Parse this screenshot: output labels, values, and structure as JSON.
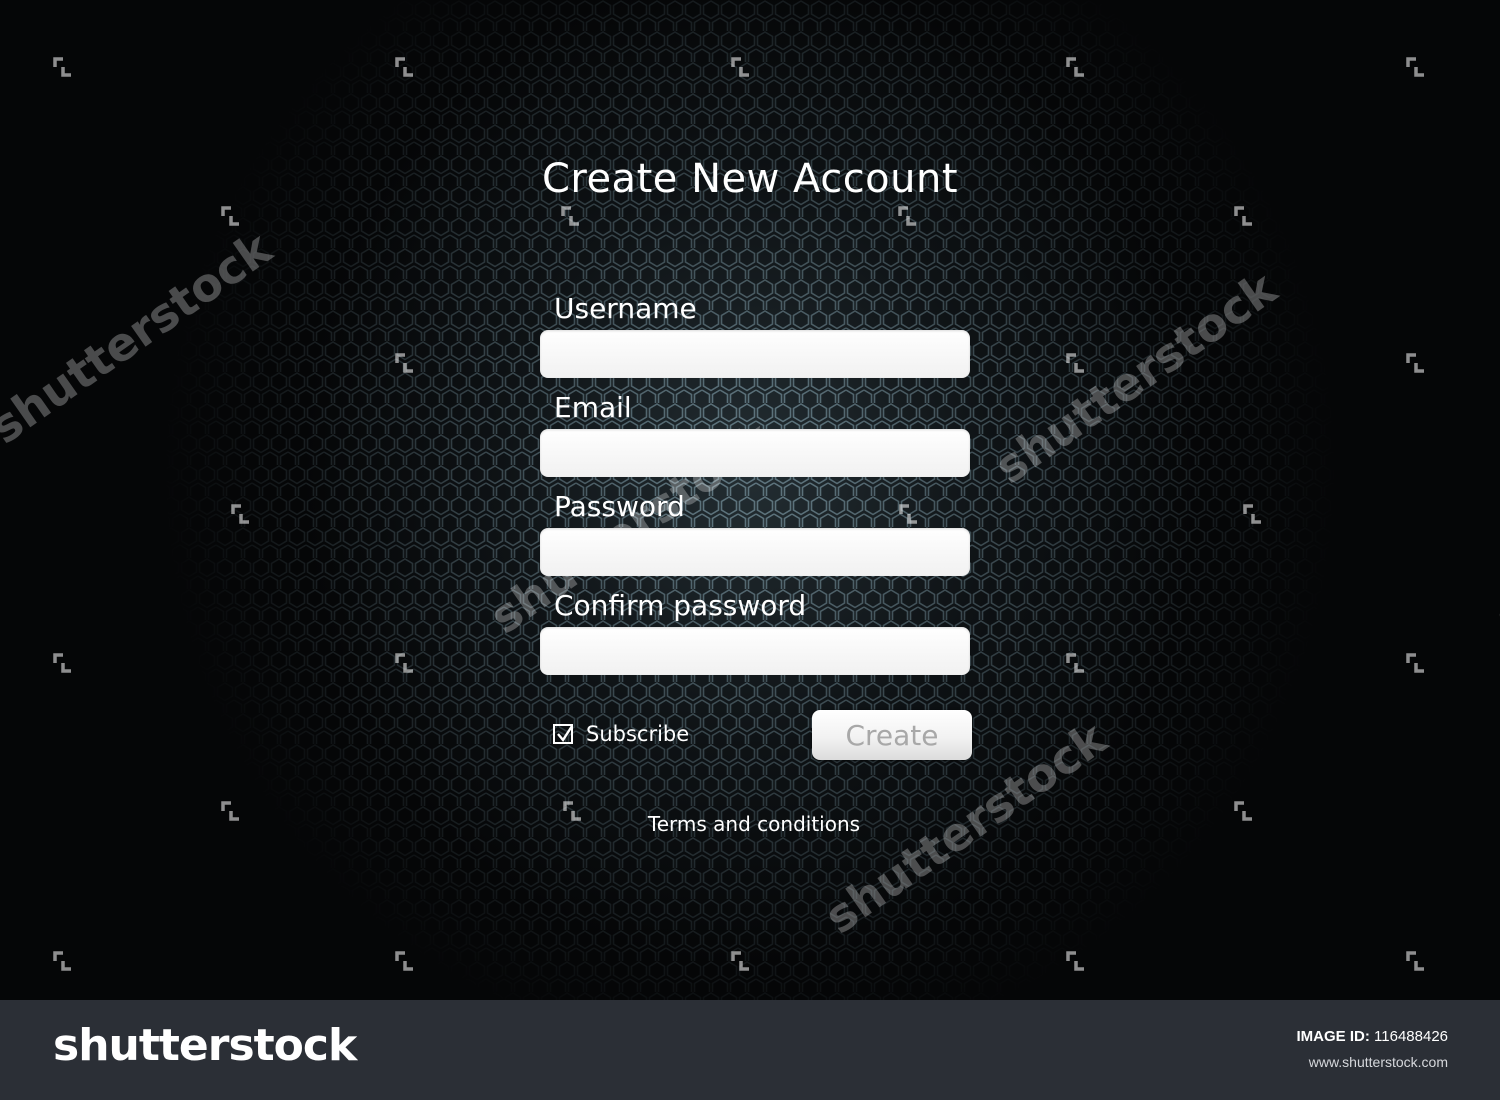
{
  "form": {
    "title": "Create New Account",
    "fields": [
      {
        "label": "Username",
        "value": "",
        "placeholder": ""
      },
      {
        "label": "Email",
        "value": "",
        "placeholder": ""
      },
      {
        "label": "Password",
        "value": "",
        "placeholder": ""
      },
      {
        "label": "Confirm password",
        "value": "",
        "placeholder": ""
      }
    ],
    "subscribe": {
      "label": "Subscribe",
      "checked": true
    },
    "create_label": "Create",
    "terms_label": "Terms and conditions"
  },
  "watermark": {
    "text": "shutterstock"
  },
  "footer": {
    "logo": "shutterstock",
    "image_id_label": "IMAGE ID:",
    "image_id": "116488426",
    "url": "www.shutterstock.com"
  },
  "colors": {
    "background": "#050607",
    "text": "#ffffff",
    "input_bg": "#ffffff",
    "button_text": "#a8a8a8",
    "footer_bg": "#2b2f36"
  }
}
